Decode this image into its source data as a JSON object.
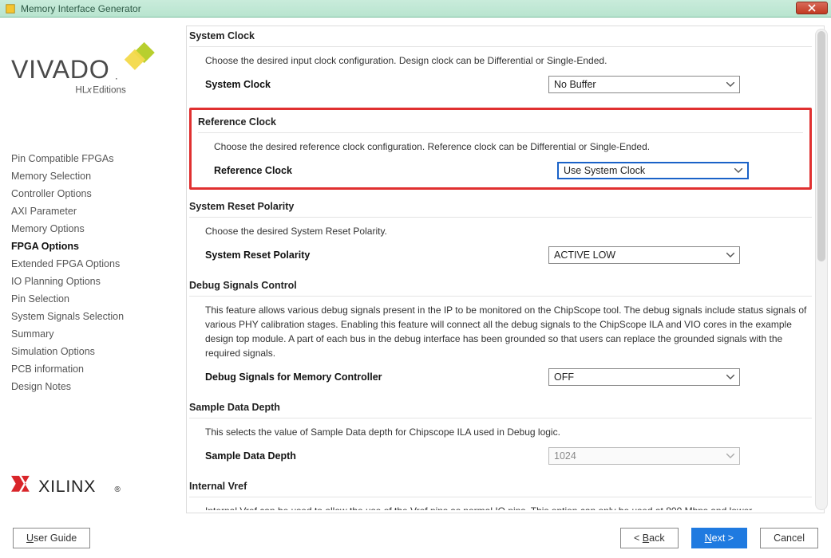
{
  "window": {
    "title": "Memory Interface Generator"
  },
  "brand": {
    "logo_top_word": "VIVADO",
    "logo_top_sub": "HLx Editions",
    "logo_bottom": "XILINX"
  },
  "sidebar": {
    "items": [
      {
        "label": "Pin Compatible FPGAs",
        "active": false
      },
      {
        "label": "Memory Selection",
        "active": false
      },
      {
        "label": "Controller Options",
        "active": false
      },
      {
        "label": "AXI Parameter",
        "active": false
      },
      {
        "label": "Memory Options",
        "active": false
      },
      {
        "label": "FPGA Options",
        "active": true
      },
      {
        "label": "Extended FPGA Options",
        "active": false
      },
      {
        "label": "IO Planning Options",
        "active": false
      },
      {
        "label": "Pin Selection",
        "active": false
      },
      {
        "label": "System Signals Selection",
        "active": false
      },
      {
        "label": "Summary",
        "active": false
      },
      {
        "label": "Simulation Options",
        "active": false
      },
      {
        "label": "PCB information",
        "active": false
      },
      {
        "label": "Design Notes",
        "active": false
      }
    ]
  },
  "sections": {
    "system_clock": {
      "title": "System Clock",
      "desc": "Choose the desired input clock configuration. Design clock can be Differential or Single-Ended.",
      "field_label": "System Clock",
      "value": "No Buffer"
    },
    "reference_clock": {
      "title": "Reference Clock",
      "desc": "Choose the desired reference clock configuration. Reference clock can be Differential or Single-Ended.",
      "field_label": "Reference Clock",
      "value": "Use System Clock"
    },
    "reset_polarity": {
      "title": "System Reset Polarity",
      "desc": "Choose the desired System Reset Polarity.",
      "field_label": "System Reset Polarity",
      "value": "ACTIVE LOW"
    },
    "debug": {
      "title": "Debug Signals Control",
      "desc": "This feature allows various debug signals present in the IP to be monitored on the ChipScope tool. The debug signals include status signals of various PHY calibration stages. Enabling this feature will connect all the debug signals to the ChipScope ILA and VIO cores in the example design top module. A part of each bus in the debug interface has been grounded so that users can replace the grounded signals with the required signals.",
      "field_label": "Debug Signals for Memory Controller",
      "value": "OFF"
    },
    "sample_depth": {
      "title": "Sample Data Depth",
      "desc": "This selects the value of Sample Data depth for Chipscope ILA used in Debug logic.",
      "field_label": "Sample Data Depth",
      "value": "1024"
    },
    "internal_vref": {
      "title": "Internal Vref",
      "desc": "Internal Vref can be used to allow the use of the Vref pins as normal IO pins. This option can only be used at 800 Mbps and lower"
    }
  },
  "footer": {
    "user_guide": "User Guide",
    "back": "Back",
    "next": "Next",
    "cancel": "Cancel"
  }
}
